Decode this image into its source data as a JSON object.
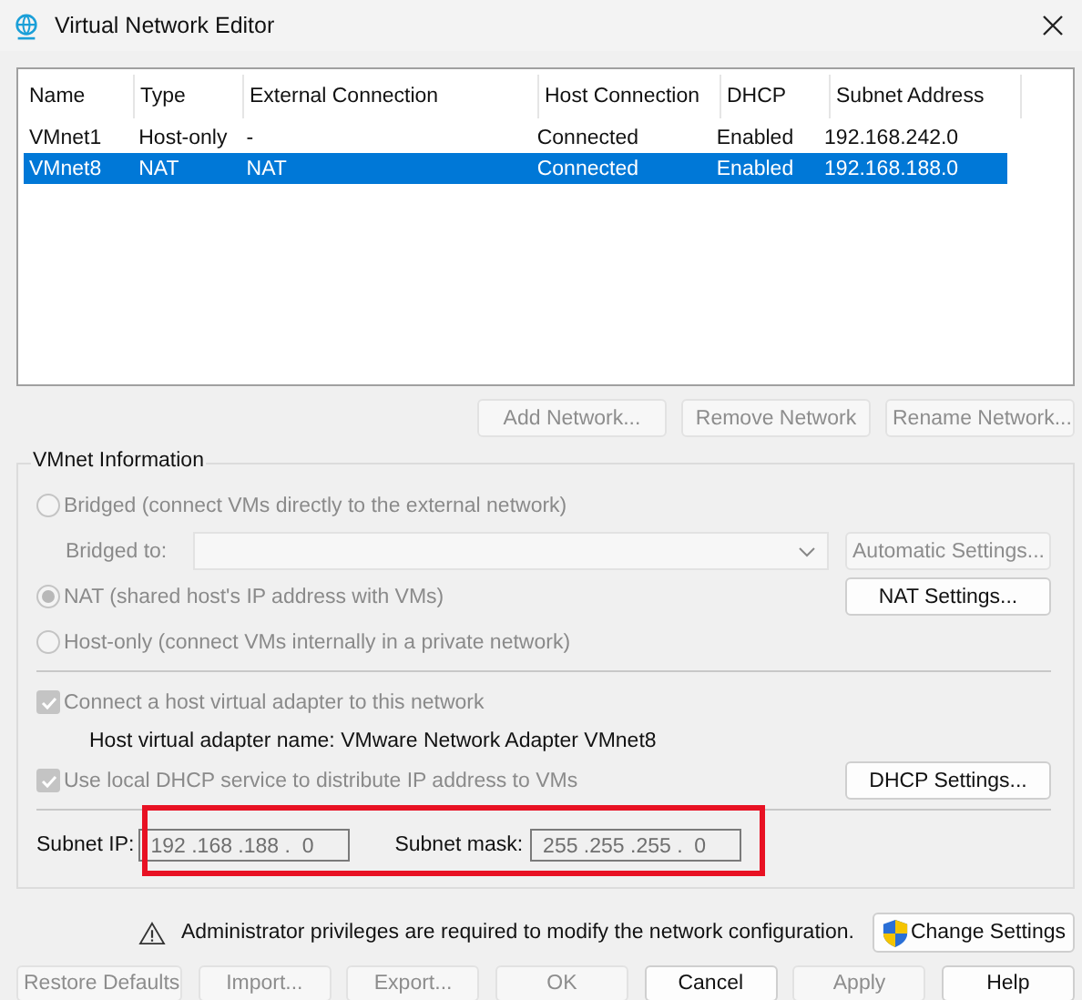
{
  "window": {
    "title": "Virtual Network Editor"
  },
  "network_table": {
    "columns": [
      "Name",
      "Type",
      "External Connection",
      "Host Connection",
      "DHCP",
      "Subnet Address"
    ],
    "rows": [
      {
        "cells": [
          "VMnet1",
          "Host-only",
          "-",
          "Connected",
          "Enabled",
          "192.168.242.0"
        ],
        "selected": false
      },
      {
        "cells": [
          "VMnet8",
          "NAT",
          "NAT",
          "Connected",
          "Enabled",
          "192.168.188.0"
        ],
        "selected": true
      }
    ]
  },
  "network_buttons": [
    {
      "label": "Add Network...",
      "disabled": true
    },
    {
      "label": "Remove Network",
      "disabled": true
    },
    {
      "label": "Rename Network...",
      "disabled": true
    }
  ],
  "vmnet_information": {
    "title": "VMnet Information",
    "bridged_radio": {
      "label": "Bridged (connect VMs directly to the external network)",
      "selected": false,
      "disabled": true
    },
    "bridged_to": {
      "label": "Bridged to:",
      "disabled": true
    },
    "automatic_settings_button": {
      "label": "Automatic Settings...",
      "disabled": true
    },
    "nat_radio": {
      "label": "NAT (shared host's IP address with VMs)",
      "selected": true,
      "disabled": true
    },
    "nat_settings_button": {
      "label": "NAT Settings...",
      "disabled": false
    },
    "host_only_radio": {
      "label": "Host-only (connect VMs internally in a private network)",
      "selected": false,
      "disabled": true
    },
    "host_adapter_checkbox": {
      "label": "Connect a host virtual adapter to this network",
      "checked": true,
      "disabled": true
    },
    "adapter_name": "Host virtual adapter name: VMware Network Adapter VMnet8",
    "dhcp_checkbox": {
      "label": "Use local DHCP service to distribute IP address to VMs",
      "checked": true,
      "disabled": true
    },
    "dhcp_settings_button": {
      "label": "DHCP Settings...",
      "disabled": false
    },
    "subnet": {
      "highlighted": true,
      "ip": {
        "label": "Subnet IP:",
        "value": "192 .168 .188 .  0"
      },
      "mask": {
        "label": "Subnet mask:",
        "value": "255 .255 .255 .  0"
      }
    }
  },
  "notice": {
    "text": "Administrator privileges are required to modify the network configuration."
  },
  "change_settings_button": {
    "label": "Change Settings",
    "disabled": false
  },
  "footer_buttons": [
    {
      "label": "Restore Defaults",
      "disabled": true
    },
    {
      "label": "Import...",
      "disabled": true
    },
    {
      "label": "Export...",
      "disabled": true
    },
    {
      "label": "OK",
      "disabled": true
    },
    {
      "label": "Cancel",
      "disabled": false
    },
    {
      "label": "Apply",
      "disabled": true
    },
    {
      "label": "Help",
      "disabled": false
    }
  ]
}
